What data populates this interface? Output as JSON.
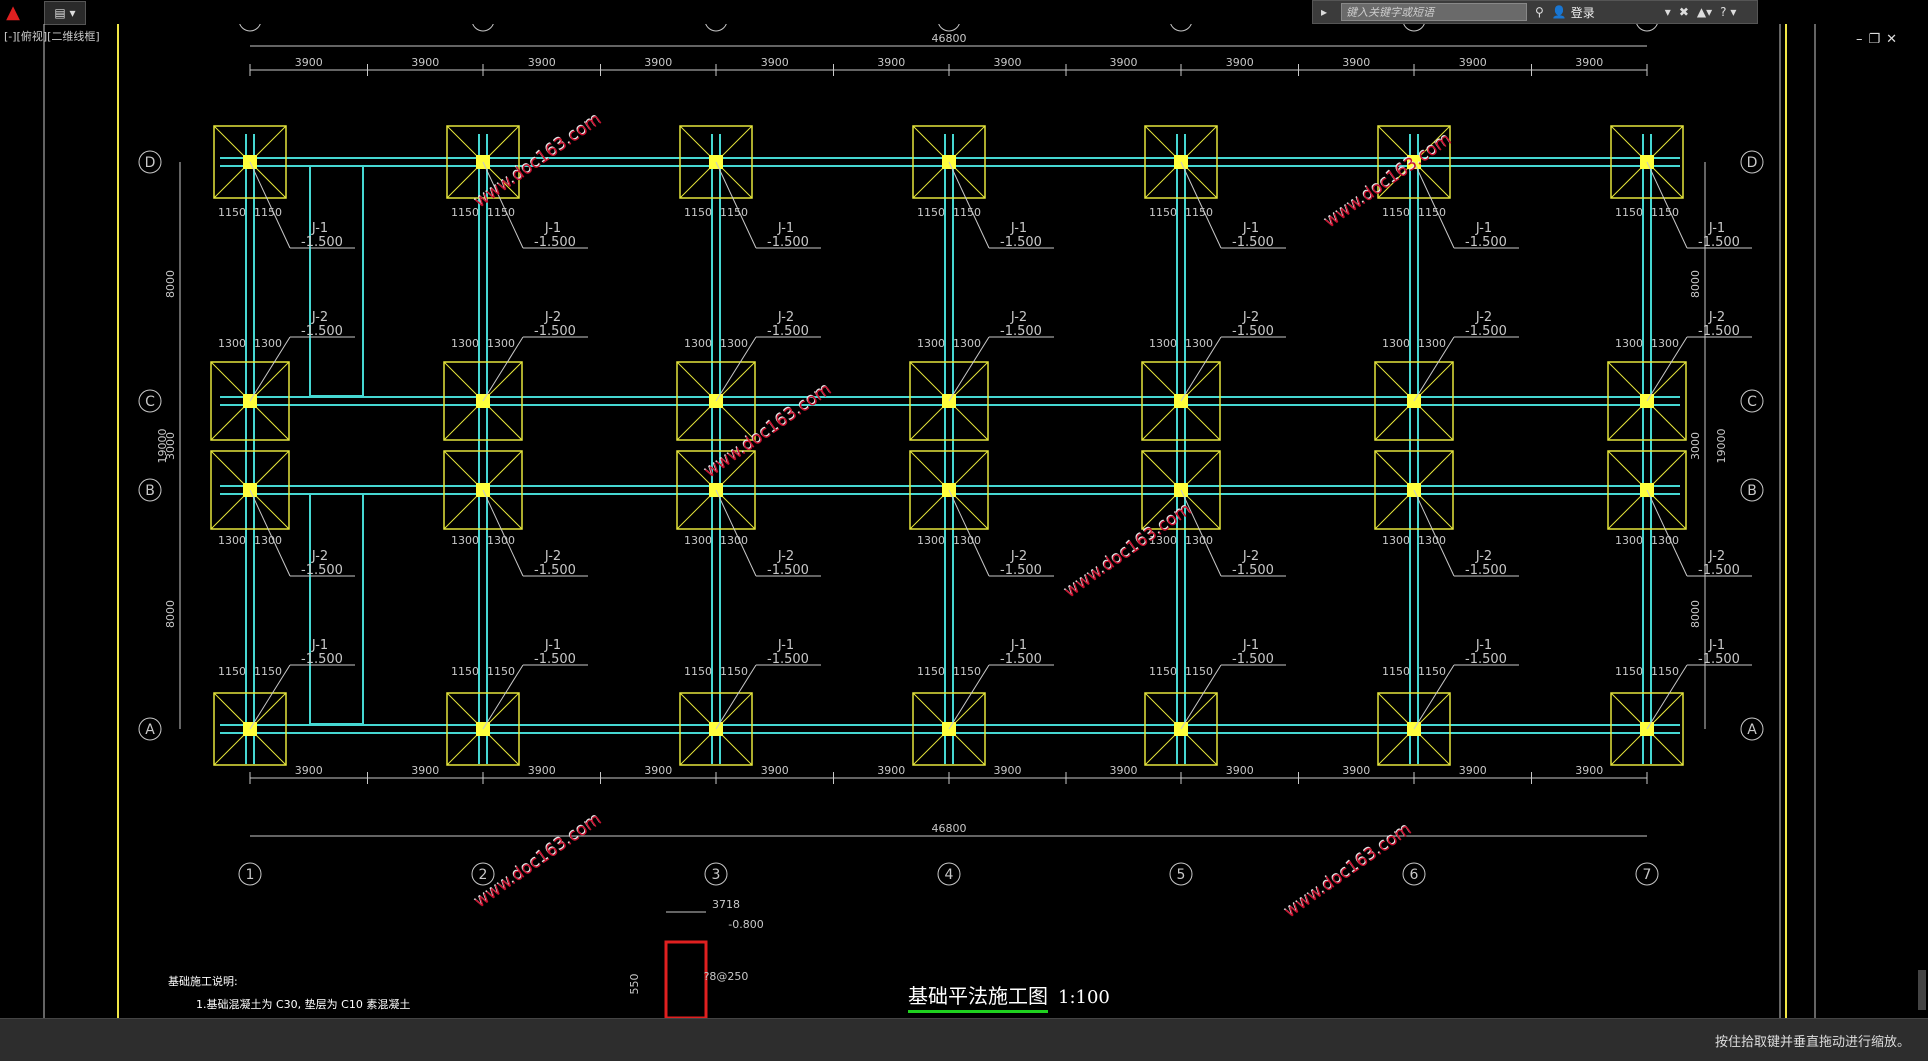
{
  "toolbar": {
    "search_placeholder": "键入关键字或短语",
    "login_label": "登录"
  },
  "viewport": {
    "label": "[-][俯视][二维线框]"
  },
  "status": {
    "text": "按住拾取键并垂直拖动进行缩放。"
  },
  "drawing": {
    "title": "基础平法施工图",
    "scale": "1:100",
    "notes_title": "基础施工说明:",
    "notes_line1": "1.基础混凝土为 C30, 垫层为 C10 素混凝土",
    "grid_columns": [
      "1",
      "2",
      "3",
      "4",
      "5",
      "6",
      "7"
    ],
    "grid_rows": [
      "D",
      "C",
      "B",
      "A"
    ],
    "bay_spacing": [
      "3900",
      "3900",
      "3900",
      "3900",
      "3900",
      "3900",
      "3900",
      "3900",
      "3900",
      "3900",
      "3900",
      "3900"
    ],
    "total_length": "46800",
    "row_spacing_left": [
      "8000",
      "3000",
      "8000"
    ],
    "total_width": "19000",
    "footing_half_J1": "1150",
    "footing_half_J2": "1300",
    "footing_labels": {
      "J1": "J-1",
      "J2": "J-2",
      "elev": "-1.500"
    },
    "section": {
      "dim_top": "3718",
      "elev": "-0.800",
      "rebar": "?8@250",
      "height": "550"
    },
    "watermark": "www.doc163.com"
  },
  "colors": {
    "background": "#000000",
    "beam": "#46d7d2",
    "footing": "#e6e63c",
    "dim": "#c8c8c8",
    "border": "#f0e646"
  }
}
